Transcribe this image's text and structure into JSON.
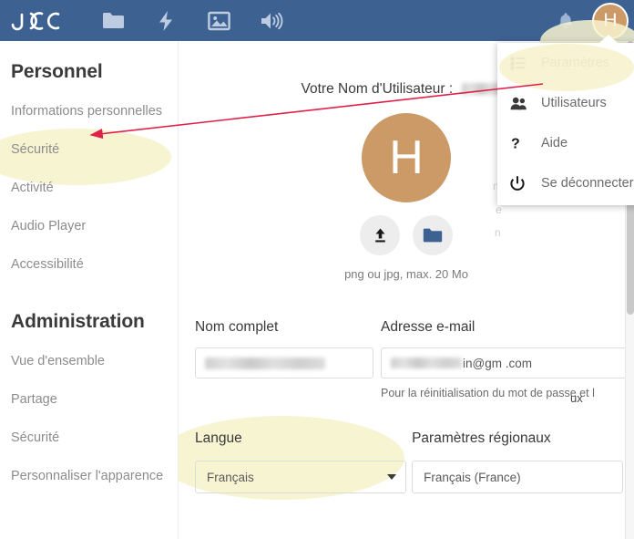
{
  "topbar": {
    "logo_text": "J DOC",
    "nav_icons": [
      {
        "name": "files-icon",
        "label": "Fichiers"
      },
      {
        "name": "activity-icon",
        "label": "Activité"
      },
      {
        "name": "photos-icon",
        "label": "Photos"
      },
      {
        "name": "music-icon",
        "label": "Musique"
      }
    ],
    "notifications_label": "Notifications",
    "avatar_initial": "H"
  },
  "usermenu": {
    "items": [
      {
        "label": "Paramètres",
        "icon": "settings-list-icon",
        "highlighted": true
      },
      {
        "label": "Utilisateurs",
        "icon": "users-icon",
        "highlighted": false
      },
      {
        "label": "Aide",
        "icon": "help-question-icon",
        "highlighted": false
      },
      {
        "label": "Se déconnecter",
        "icon": "power-icon",
        "highlighted": false
      }
    ]
  },
  "sidebar": {
    "personal_heading": "Personnel",
    "personal_items": [
      {
        "label": "Informations personnelles",
        "active": true
      },
      {
        "label": "Sécurité",
        "active": false
      },
      {
        "label": "Activité",
        "active": false
      },
      {
        "label": "Audio Player",
        "active": false
      },
      {
        "label": "Accessibilité",
        "active": false
      }
    ],
    "admin_heading": "Administration",
    "admin_items": [
      {
        "label": "Vue d'ensemble",
        "active": false
      },
      {
        "label": "Partage",
        "active": false
      },
      {
        "label": "Sécurité",
        "active": false
      },
      {
        "label": "Personnaliser l'apparence",
        "active": false
      }
    ]
  },
  "main": {
    "username_prefix": "Votre Nom d'Utilisateur :",
    "username_value_redacted": true,
    "avatar_initial": "H",
    "upload_button_label": "Téléverser une nouvelle image",
    "select_button_label": "Sélectionner depuis les fichiers",
    "avatar_hint": "png ou jpg, max. 20 Mo",
    "fields": [
      {
        "label": "Nom complet",
        "value": "",
        "redacted": true,
        "help": ""
      },
      {
        "label": "Adresse e-mail",
        "value": "in@gm  .com",
        "redacted_prefix": true,
        "help": "Pour la réinitialisation du mot de passe et l"
      }
    ],
    "language": {
      "label": "Langue",
      "selected": "Français"
    },
    "locale": {
      "label": "Paramètres régionaux",
      "selected": "Français (France)"
    },
    "ghost_text": [
      "ns",
      "e",
      "n",
      "ux"
    ]
  },
  "colors": {
    "topbar_bg": "#3d6191",
    "avatar_bg": "#cc9a66",
    "highlight": "#f7f3cf",
    "annotation_arrow": "#e0204a",
    "text_primary": "#3a3a3a",
    "text_muted": "#8c8c8c"
  },
  "annotation": {
    "arrow_from_label": "Paramètres",
    "arrow_to_label": "Informations personnelles"
  }
}
